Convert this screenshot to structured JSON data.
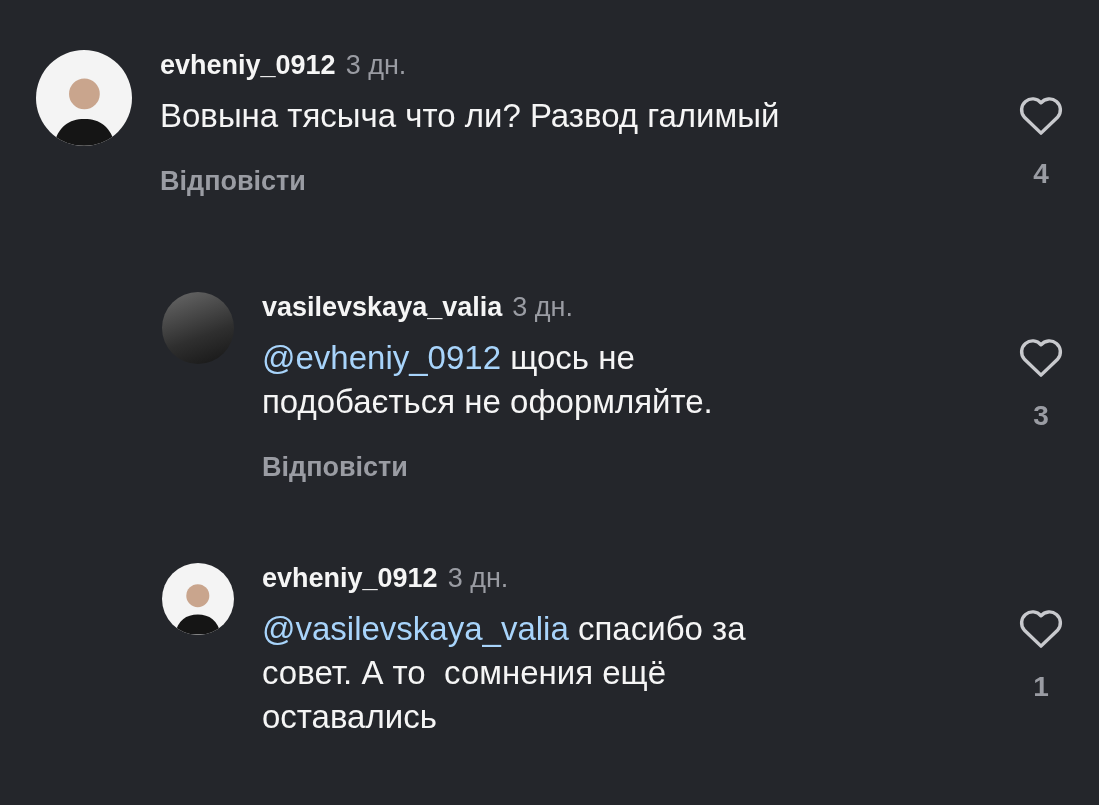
{
  "comments": [
    {
      "username": "evheniy_0912",
      "time": "3 дн.",
      "text": "Вовына тясыча что ли? Развод галимый",
      "reply_label": "Відповісти",
      "likes": "4",
      "liked": false,
      "kind": "light",
      "replies": [
        {
          "username": "vasilevskaya_valia",
          "time": "3 дн.",
          "mention": "@evheniy_0912",
          "text": "щось не подобається не оформляйте.",
          "reply_label": "Відповісти",
          "likes": "3",
          "liked": false,
          "kind": "dark"
        },
        {
          "username": "evheniy_0912",
          "time": "3 дн.",
          "mention": "@vasilevskaya_valia",
          "text": "спасибо за совет. А то  сомнения ещё оставались",
          "likes": "1",
          "liked": false,
          "kind": "light"
        }
      ]
    }
  ]
}
